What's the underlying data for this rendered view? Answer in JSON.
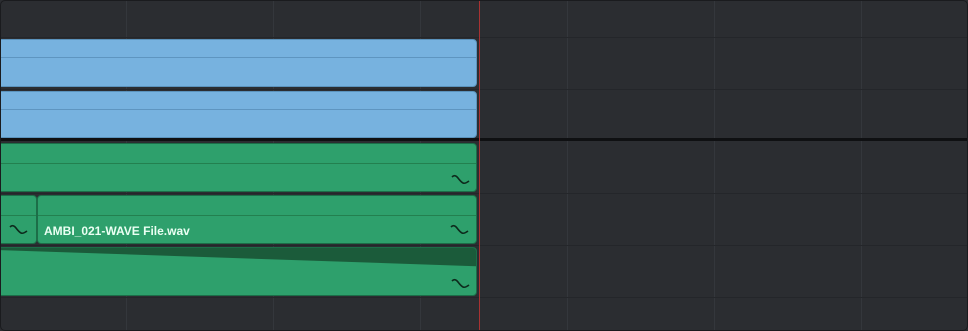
{
  "timeline": {
    "audio_clip_name": "AMBI_021-WAVE File.wav",
    "icons": {
      "waveform": "waveform-icon"
    },
    "colors": {
      "background": "#2b2d31",
      "video_clip": "#77b2df",
      "audio_clip": "#2ea06c",
      "playhead": "#a83232"
    }
  }
}
